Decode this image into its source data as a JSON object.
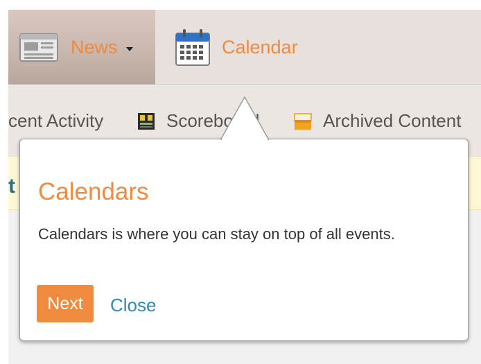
{
  "nav": {
    "items": [
      {
        "label": "News",
        "icon": "newspaper-icon",
        "has_dropdown": true,
        "active": true
      },
      {
        "label": "Calendar",
        "icon": "calendar-icon",
        "has_dropdown": false,
        "active": false
      }
    ]
  },
  "subnav": {
    "items": [
      {
        "label": "cent Activity",
        "icon": ""
      },
      {
        "label": "Scoreboard",
        "icon": "scoreboard-icon"
      },
      {
        "label": "Archived Content",
        "icon": "archive-box-icon"
      }
    ]
  },
  "notice": {
    "visible_char": "t"
  },
  "popover": {
    "title": "Calendars",
    "body": "Calendars is where you can stay on top of all events.",
    "next_label": "Next",
    "close_label": "Close"
  },
  "colors": {
    "accent_orange": "#ef8a3e",
    "link_blue": "#2d8ab4",
    "nav_bg": "#e8e0dc"
  }
}
